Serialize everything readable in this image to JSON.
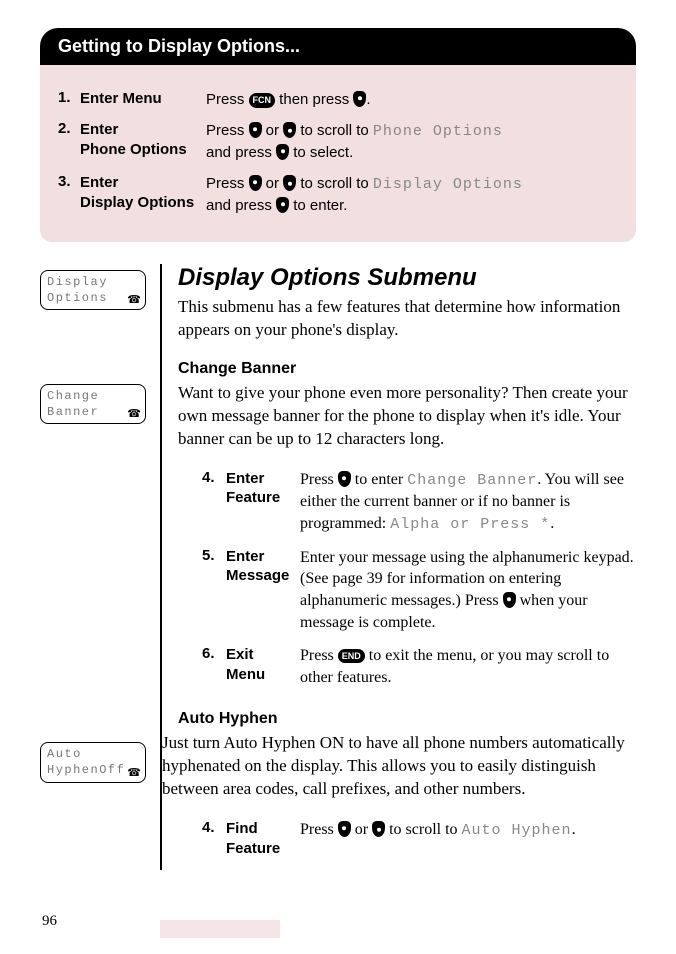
{
  "header": {
    "title": "Getting to Display  Options...",
    "steps": [
      {
        "num": "1.",
        "label": "Enter Menu",
        "pre": "Press ",
        "mid": " then press ",
        "post": "."
      },
      {
        "num": "2.",
        "label": "Enter\nPhone Options",
        "pre": "Press ",
        "or": " or ",
        "mid": " to scroll to ",
        "lcd": "Phone Options",
        "line2a": "and press ",
        "line2b": " to select."
      },
      {
        "num": "3.",
        "label": "Enter\nDisplay Options",
        "pre": "Press ",
        "or": " or ",
        "mid": " to scroll to ",
        "lcd": "Display Options",
        "line2a": "and press ",
        "line2b": " to enter."
      }
    ]
  },
  "lcd_boxes": {
    "display_options": {
      "l1": "Display",
      "l2": "Options"
    },
    "change_banner": {
      "l1": "Change",
      "l2": "Banner"
    },
    "auto_hyphen": {
      "l1": "Auto",
      "l2": "HyphenOff"
    }
  },
  "section": {
    "title": "Display Options Submenu",
    "intro": "This submenu has a few features that determine how information appears on your phone's display.",
    "change_banner": {
      "head": "Change Banner",
      "body": "Want to give your phone even more personality? Then create your own message banner for the phone to display when it's idle. Your banner can be up to 12 characters long.",
      "steps": [
        {
          "num": "4.",
          "label": "Enter\nFeature",
          "t1": "Press ",
          "t2": " to enter ",
          "lcd1": "Change Banner",
          "t3": ". You will see either the current banner or if no banner is programmed: ",
          "lcd2": "Alpha or Press *",
          "t4": "."
        },
        {
          "num": "5.",
          "label": "Enter\nMessage",
          "t1": "Enter your message using the alphanumeric keypad. (See page 39 for information on entering alphanumeric messages.) Press ",
          "t2": " when your message is complete."
        },
        {
          "num": "6.",
          "label": "Exit\nMenu",
          "t1": "Press ",
          "t2": " to exit the menu, or you may scroll to other features."
        }
      ]
    },
    "auto_hyphen": {
      "head": "Auto Hyphen",
      "body": "Just turn Auto Hyphen ON to have all phone numbers automatically hyphenated on the display. This allows you to easily distinguish between area codes, call prefixes, and other numbers.",
      "steps": [
        {
          "num": "4.",
          "label": "Find\nFeature",
          "t1": "Press ",
          "or": " or ",
          "t2": " to scroll to ",
          "lcd": "Auto Hyphen",
          "t3": "."
        }
      ]
    }
  },
  "pills": {
    "fcn": "FCN",
    "end": "END"
  },
  "page_num": "96",
  "phone_glyph": "☎"
}
